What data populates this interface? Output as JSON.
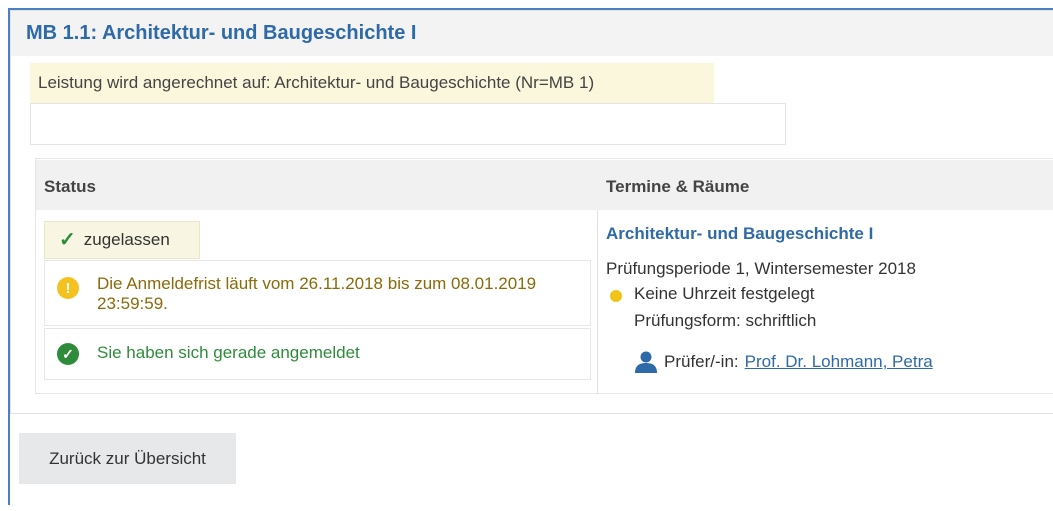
{
  "module": {
    "title": "MB 1.1: Architektur- und Baugeschichte I",
    "credit_note": "Leistung wird angerechnet auf: Architektur- und Baugeschichte (Nr=MB 1)"
  },
  "table": {
    "headers": {
      "status": "Status",
      "dates_rooms": "Termine & Räume"
    }
  },
  "status": {
    "chip_label": "zugelassen",
    "warning_message": "Die Anmeldefrist läuft vom 26.11.2018 bis zum 08.01.2019 23:59:59.",
    "success_message": "Sie haben sich gerade angemeldet"
  },
  "exam": {
    "title": "Architektur- und Baugeschichte I",
    "period": "Prüfungsperiode 1, Wintersemester 2018",
    "time": "Keine Uhrzeit festgelegt",
    "form": "Prüfungsform: schriftlich",
    "examiner_label": "Prüfer/-in:",
    "examiner_name": "Prof. Dr. Lohmann, Petra"
  },
  "actions": {
    "back_label": "Zurück zur Übersicht"
  },
  "colors": {
    "accent": "#2f6aa8",
    "success": "#2e8b3a",
    "warning_text": "#8a6a0a",
    "warning_icon": "#f5c11e",
    "note_bg": "#fbf7dd"
  },
  "icons": {
    "check": "check-icon",
    "warning": "info-warning-icon",
    "success": "check-circle-icon",
    "time": "yellow-dot-icon",
    "examiner": "person-icon"
  }
}
